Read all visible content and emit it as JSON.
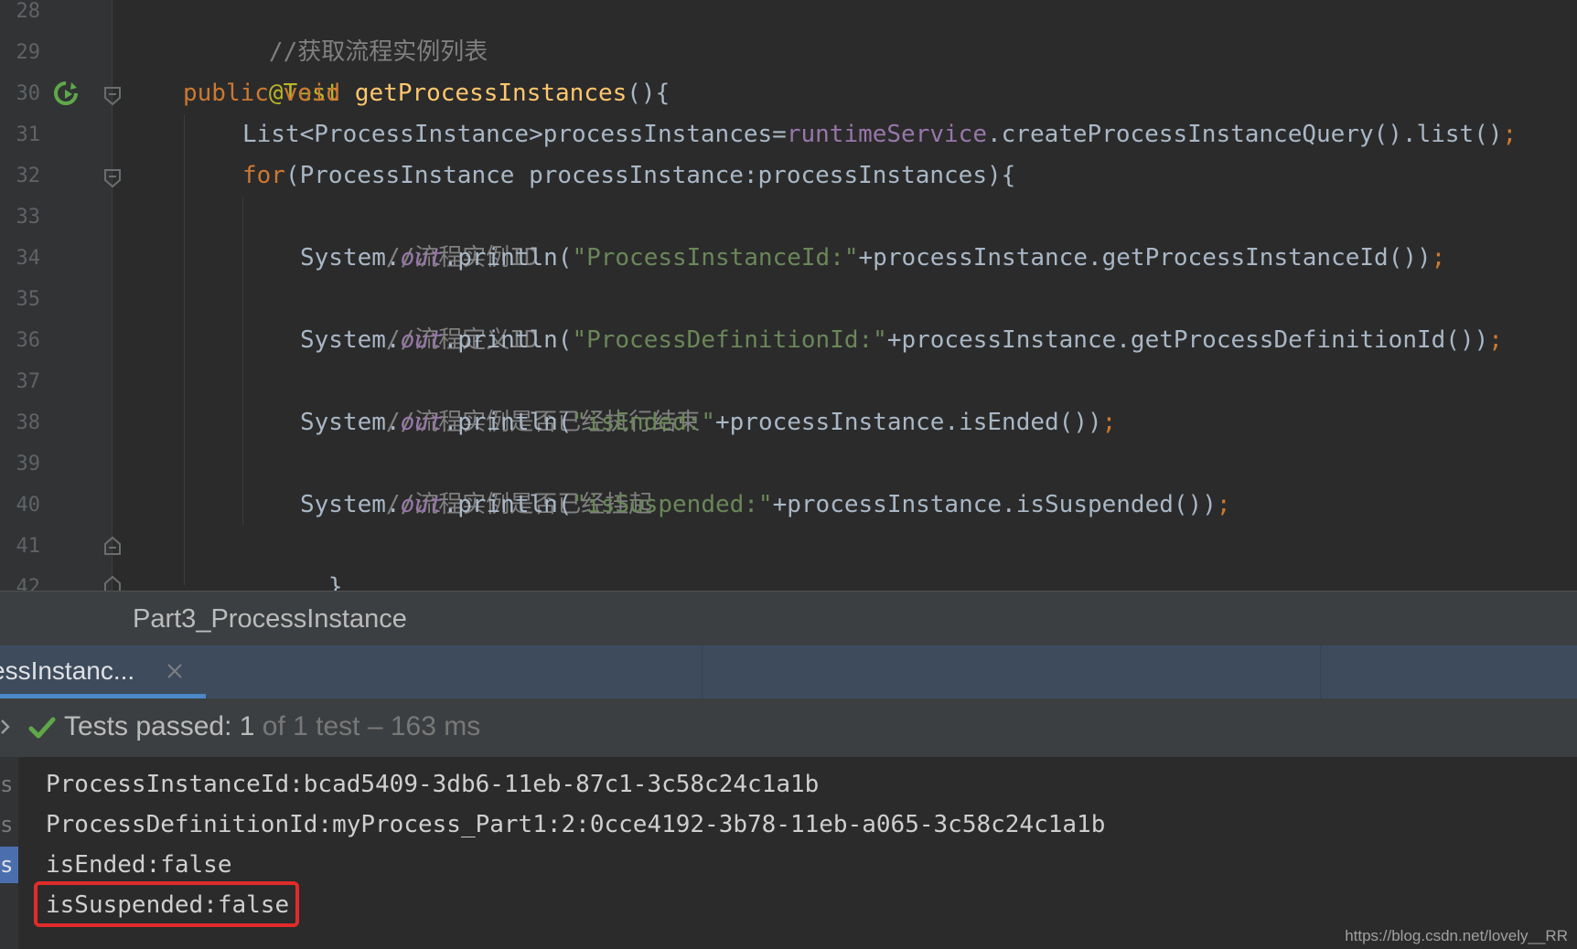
{
  "editor": {
    "line_numbers": [
      "28",
      "29",
      "30",
      "31",
      "32",
      "33",
      "34",
      "35",
      "36",
      "37",
      "38",
      "39",
      "40",
      "41",
      "42"
    ],
    "code": {
      "l28": {
        "comment": "//获取流程实例列表"
      },
      "l29": {
        "annotation": "@Test"
      },
      "l30": {
        "kw_public": "public",
        "kw_void": "void",
        "method": "getProcessInstances",
        "rest": "(){"
      },
      "l31": {
        "part1": "List<ProcessInstance>processInstances=",
        "field": "runtimeService",
        "part2": ".createProcessInstanceQuery().list()",
        "semi": ";"
      },
      "l32": {
        "kw_for": "for",
        "rest": "(ProcessInstance processInstance:processInstances){"
      },
      "l33": {
        "comment": "//流程实例ID"
      },
      "l34": {
        "sys": "System.",
        "out": "out",
        "call": ".println(",
        "str": "\"ProcessInstanceId:\"",
        "rest": "+processInstance.getProcessInstanceId())",
        "semi": ";"
      },
      "l35": {
        "comment": "//流程定义ID"
      },
      "l36": {
        "sys": "System.",
        "out": "out",
        "call": ".println(",
        "str": "\"ProcessDefinitionId:\"",
        "rest": "+processInstance.getProcessDefinitionId())",
        "semi": ";"
      },
      "l37": {
        "comment": "//流程实例是否已经执行结束"
      },
      "l38": {
        "sys": "System.",
        "out": "out",
        "call": ".println(",
        "str": "\"isEnded:\"",
        "rest": "+processInstance.isEnded())",
        "semi": ";"
      },
      "l39": {
        "comment": "//流程实例是否已经挂起"
      },
      "l40": {
        "sys": "System.",
        "out": "out",
        "call": ".println(",
        "str": "\"isSuspended:\"",
        "rest": "+processInstance.isSuspended())",
        "semi": ";"
      },
      "l41": {
        "brace": "}"
      },
      "l42": {
        "brace": "}"
      }
    }
  },
  "run_window": {
    "title": "Part3_ProcessInstance",
    "tab_label": "essInstanc...",
    "status": {
      "passed": "Tests passed: 1",
      "rest": " of 1 test – 163 ms"
    },
    "left_strip": [
      "s",
      "s",
      "s"
    ],
    "output": [
      "ProcessInstanceId:bcad5409-3db6-11eb-87c1-3c58c24c1a1b",
      "ProcessDefinitionId:myProcess_Part1:2:0cce4192-3b78-11eb-a065-3c58c24c1a1b",
      "isEnded:false",
      "isSuspended:false"
    ]
  },
  "watermark": "https://blog.csdn.net/lovely__RR",
  "colors": {
    "highlight_box": "#e12b2b",
    "check": "#5fa84a",
    "tab_underline": "#4a88c7"
  }
}
